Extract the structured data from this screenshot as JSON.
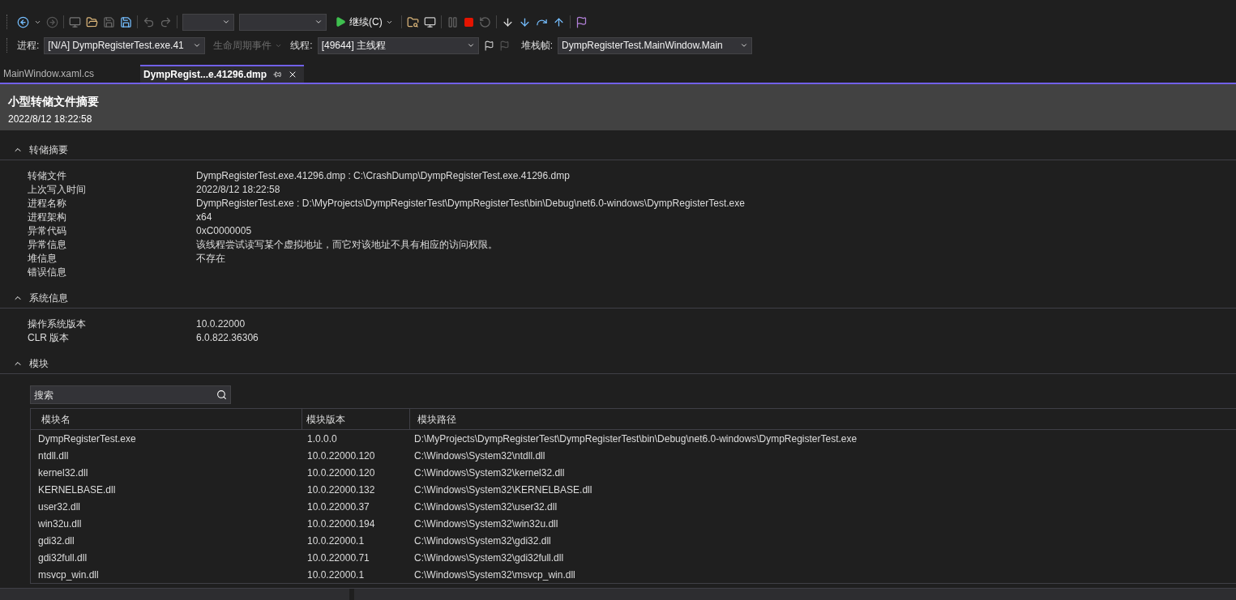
{
  "toolbar": {
    "continue_button": "继续(C)"
  },
  "debug_location": {
    "process_label": "进程:",
    "process_value": "[N/A] DympRegisterTest.exe.41",
    "lifecycle_events": "生命周期事件",
    "thread_label": "线程:",
    "thread_value": "[49644] 主线程",
    "stack_frame_label": "堆栈帧:",
    "stack_frame_value": "DympRegisterTest.MainWindow.Main"
  },
  "tabs": [
    {
      "label": "MainWindow.xaml.cs",
      "selected": false
    },
    {
      "label": "DympRegist...e.41296.dmp",
      "selected": true
    }
  ],
  "header": {
    "title": "小型转储文件摘要",
    "timestamp": "2022/8/12 18:22:58"
  },
  "sections": [
    {
      "title": "转储摘要",
      "expanded": true,
      "rows": [
        {
          "label": "转储文件",
          "value": "DympRegisterTest.exe.41296.dmp : C:\\CrashDump\\DympRegisterTest.exe.41296.dmp"
        },
        {
          "label": "上次写入时间",
          "value": "2022/8/12 18:22:58"
        },
        {
          "label": "进程名称",
          "value": "DympRegisterTest.exe : D:\\MyProjects\\DympRegisterTest\\DympRegisterTest\\bin\\Debug\\net6.0-windows\\DympRegisterTest.exe"
        },
        {
          "label": "进程架构",
          "value": "x64"
        },
        {
          "label": "异常代码",
          "value": "0xC0000005"
        },
        {
          "label": "异常信息",
          "value": "该线程尝试读写某个虚拟地址，而它对该地址不具有相应的访问权限。"
        },
        {
          "label": "堆信息",
          "value": "不存在"
        },
        {
          "label": "错误信息"
        }
      ]
    },
    {
      "title": "系统信息",
      "expanded": true,
      "rows": [
        {
          "label": "操作系统版本",
          "value": "10.0.22000"
        },
        {
          "label": "CLR 版本",
          "value": "6.0.822.36306"
        }
      ]
    }
  ],
  "modules": {
    "title": "模块",
    "expanded": true,
    "search": {
      "placeholder": "搜索"
    },
    "columns": [
      "模块名",
      "模块版本",
      "模块路径"
    ],
    "rows": [
      [
        "DympRegisterTest.exe",
        "1.0.0.0",
        "D:\\MyProjects\\DympRegisterTest\\DympRegisterTest\\bin\\Debug\\net6.0-windows\\DympRegisterTest.exe"
      ],
      [
        "ntdll.dll",
        "10.0.22000.120",
        "C:\\Windows\\System32\\ntdll.dll"
      ],
      [
        "kernel32.dll",
        "10.0.22000.120",
        "C:\\Windows\\System32\\kernel32.dll"
      ],
      [
        "KERNELBASE.dll",
        "10.0.22000.132",
        "C:\\Windows\\System32\\KERNELBASE.dll"
      ],
      [
        "user32.dll",
        "10.0.22000.37",
        "C:\\Windows\\System32\\user32.dll"
      ],
      [
        "win32u.dll",
        "10.0.22000.194",
        "C:\\Windows\\System32\\win32u.dll"
      ],
      [
        "gdi32.dll",
        "10.0.22000.1",
        "C:\\Windows\\System32\\gdi32.dll"
      ],
      [
        "gdi32full.dll",
        "10.0.22000.71",
        "C:\\Windows\\System32\\gdi32full.dll"
      ],
      [
        "msvcp_win.dll",
        "10.0.22000.1",
        "C:\\Windows\\System32\\msvcp_win.dll"
      ]
    ]
  }
}
